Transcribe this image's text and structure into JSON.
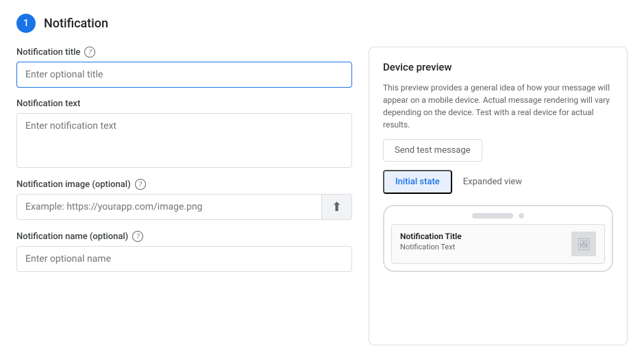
{
  "step": {
    "number": "1",
    "title": "Notification"
  },
  "fields": {
    "title_label": "Notification title",
    "title_placeholder": "Enter optional title",
    "text_label": "Notification text",
    "text_placeholder": "Enter notification text",
    "image_label": "Notification image (optional)",
    "image_placeholder": "Example: https://yourapp.com/image.png",
    "name_label": "Notification name (optional)",
    "name_placeholder": "Enter optional name"
  },
  "preview": {
    "title": "Device preview",
    "description": "This preview provides a general idea of how your message will appear on a mobile device. Actual message rendering will vary depending on the device. Test with a real device for actual results.",
    "send_test_button": "Send test message",
    "tabs": [
      {
        "label": "Initial state",
        "active": true
      },
      {
        "label": "Expanded view",
        "active": false
      }
    ],
    "notification": {
      "title": "Notification Title",
      "body": "Notification Text"
    }
  },
  "icons": {
    "help": "?",
    "upload": "⬆",
    "image": "🖼"
  }
}
